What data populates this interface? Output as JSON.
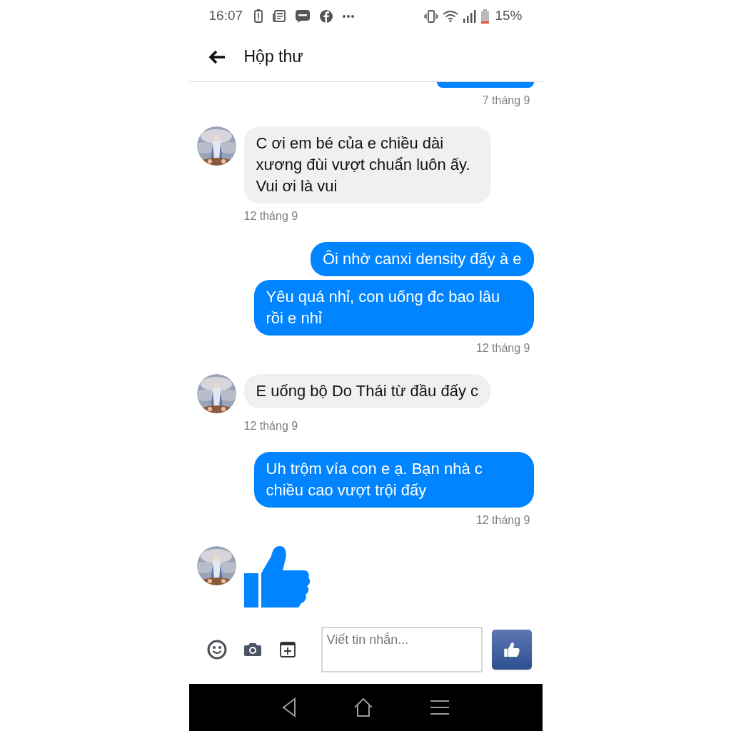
{
  "status_bar": {
    "time": "16:07",
    "battery": "15%"
  },
  "header": {
    "title": "Hộp thư"
  },
  "messages": [
    {
      "kind": "clipped"
    },
    {
      "kind": "date",
      "text": "7 tháng 9"
    },
    {
      "kind": "incoming",
      "text": "C ơi em bé của e chiều dài xương đùi vượt chuẩn luôn ấy. Vui ơi là vui"
    },
    {
      "kind": "date",
      "text": "12 tháng 9"
    },
    {
      "kind": "outgoing",
      "text": "Ôi nhờ canxi density đấy à e"
    },
    {
      "kind": "outgoing",
      "text": "Yêu quá nhỉ, con uống đc bao lâu rồi e nhỉ"
    },
    {
      "kind": "date",
      "text": "12 tháng 9"
    },
    {
      "kind": "incoming",
      "text": "E uống bộ Do Thái từ đầu đấy c"
    },
    {
      "kind": "date",
      "text": "12 tháng 9"
    },
    {
      "kind": "outgoing",
      "text": "Uh trộm vía con e ạ. Bạn nhà c chiều cao vượt trội đấy"
    },
    {
      "kind": "date",
      "text": "12 tháng 9"
    },
    {
      "kind": "like"
    }
  ],
  "composer": {
    "placeholder": "Viết tin nhắn..."
  }
}
